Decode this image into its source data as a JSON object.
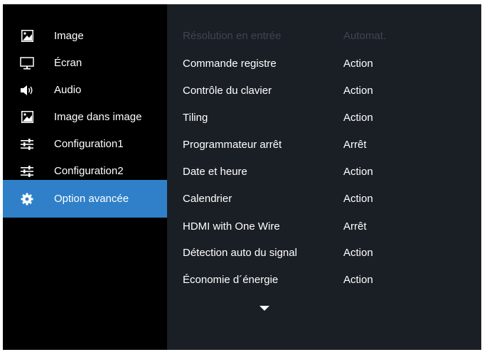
{
  "sidebar": {
    "items": [
      {
        "label": "Image",
        "icon": "picture-icon"
      },
      {
        "label": "Écran",
        "icon": "monitor-icon"
      },
      {
        "label": "Audio",
        "icon": "speaker-icon"
      },
      {
        "label": "Image dans image",
        "icon": "picture-icon"
      },
      {
        "label": "Configuration1",
        "icon": "sliders-icon"
      },
      {
        "label": "Configuration2",
        "icon": "sliders-icon"
      },
      {
        "label": "Option avancée",
        "icon": "gear-icon",
        "active": true
      }
    ]
  },
  "menu": {
    "rows": [
      {
        "label": "Résolution en entrée",
        "value": "Automat.",
        "disabled": true
      },
      {
        "label": "Commande registre",
        "value": "Action"
      },
      {
        "label": "Contrôle du clavier",
        "value": "Action"
      },
      {
        "label": "Tiling",
        "value": "Action"
      },
      {
        "label": "Programmateur arrêt",
        "value": "Arrêt"
      },
      {
        "label": "Date et heure",
        "value": "Action"
      },
      {
        "label": "Calendrier",
        "value": "Action"
      },
      {
        "label": "HDMI with One Wire",
        "value": "Arrêt"
      },
      {
        "label": "Détection auto du signal",
        "value": "Action"
      },
      {
        "label": "Économie d´énergie",
        "value": "Action"
      }
    ],
    "scroll_icon": "chevron-down-icon"
  },
  "colors": {
    "sidebar_bg": "#000000",
    "content_bg": "#1a1f25",
    "active_bg": "#2f80c9",
    "text": "#ffffff",
    "disabled_text": "#3f4650"
  }
}
